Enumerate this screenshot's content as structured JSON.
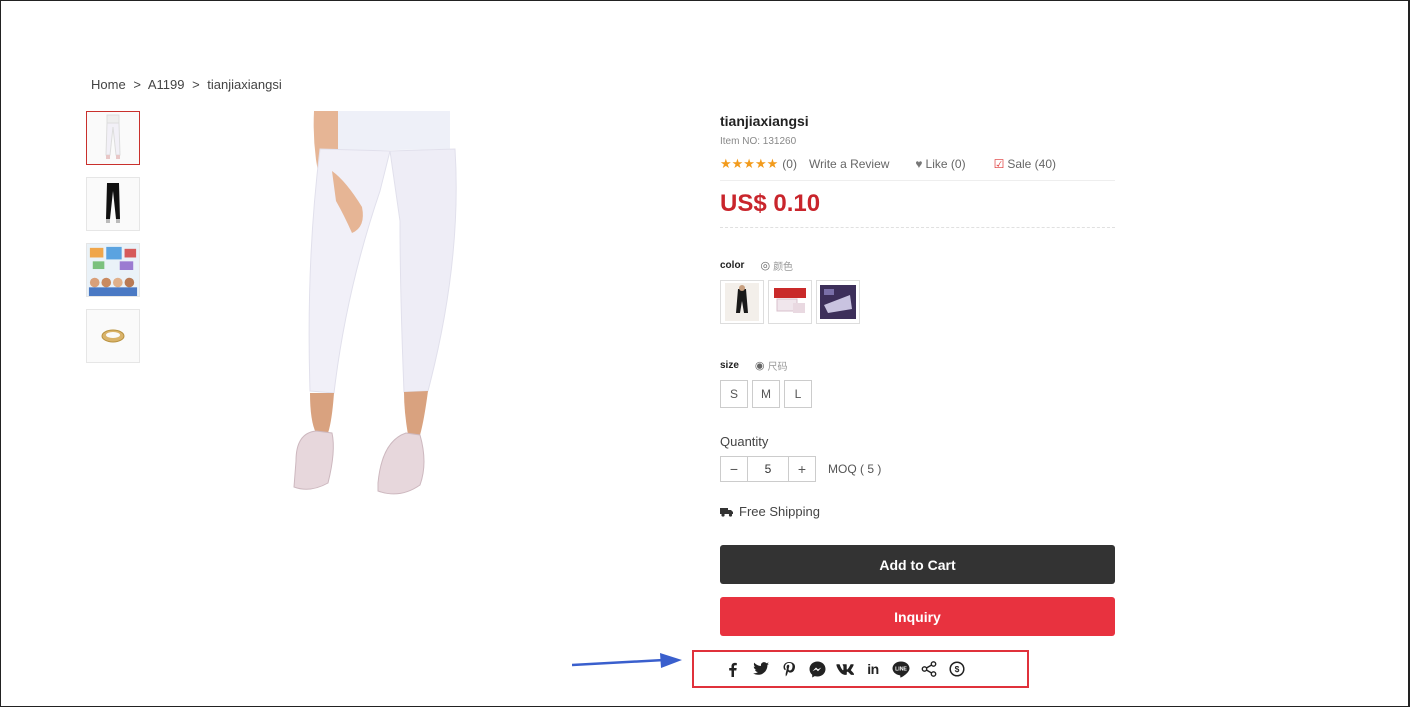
{
  "breadcrumb": {
    "items": [
      "Home",
      ">",
      "A1199",
      ">",
      "tianjiaxiangsi"
    ]
  },
  "product": {
    "title": "tianjiaxiangsi",
    "item_no": "Item NO: 131260",
    "stars": "★★★★★",
    "rating_count": "(0)",
    "write_review": "Write a Review",
    "like": "Like (0)",
    "sale": "Sale (40)",
    "price": "US$ 0.10"
  },
  "options": {
    "color_label": "color",
    "color_hint": "颜色",
    "size_label": "size",
    "size_hint": "尺码",
    "sizes": [
      "S",
      "M",
      "L"
    ]
  },
  "quantity": {
    "label": "Quantity",
    "minus": "−",
    "value": "5",
    "plus": "+",
    "moq": "MOQ ( 5 )"
  },
  "shipping": {
    "text": "Free Shipping"
  },
  "buttons": {
    "add_to_cart": "Add to Cart",
    "inquiry": "Inquiry"
  },
  "share": {
    "icons": [
      "facebook-icon",
      "twitter-icon",
      "pinterest-icon",
      "messenger-icon",
      "vk-icon",
      "linkedin-icon",
      "line-icon",
      "share-icon",
      "other-icon"
    ]
  },
  "colors": {
    "price": "#c9252c",
    "inquiry": "#e8323f",
    "cart": "#333333",
    "stars": "#f29b1c",
    "highlight": "#e0313b",
    "arrow": "#3a5fcd"
  }
}
